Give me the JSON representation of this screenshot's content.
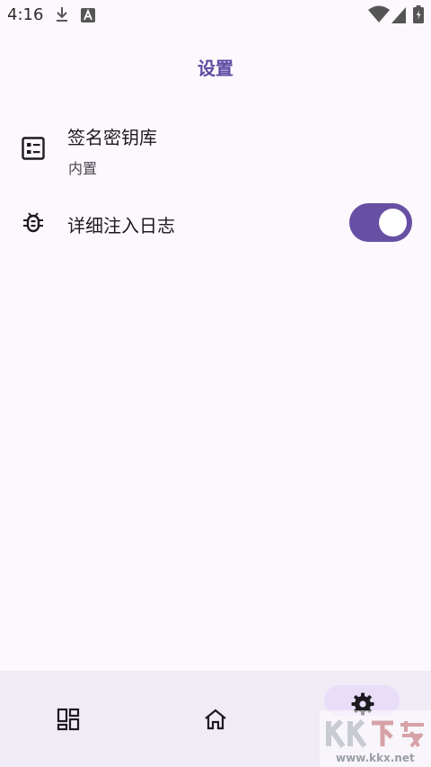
{
  "status_bar": {
    "time": "4:16",
    "icons": [
      "download-icon",
      "a-notification-icon",
      "wifi-icon",
      "cell-signal-icon",
      "battery-icon"
    ]
  },
  "top_bar": {
    "title": "设置"
  },
  "settings": {
    "keystore": {
      "title": "签名密钥库",
      "subtitle": "内置",
      "icon": "keystore-icon"
    },
    "verbose_log": {
      "title": "详细注入日志",
      "icon": "bug-icon",
      "enabled": true
    }
  },
  "bottom_nav": {
    "items": [
      {
        "icon": "apps-icon",
        "selected": false
      },
      {
        "icon": "home-icon",
        "selected": false
      },
      {
        "icon": "settings-gear-icon",
        "selected": true
      }
    ]
  },
  "watermark": {
    "logo_text": "KK下载",
    "url": "www.kkx.net"
  },
  "colors": {
    "background": "#fdf8fd",
    "accent": "#6750a4",
    "title": "#5b4aa0",
    "nav_background": "#f1ebf5",
    "nav_pill": "#e8def8"
  }
}
